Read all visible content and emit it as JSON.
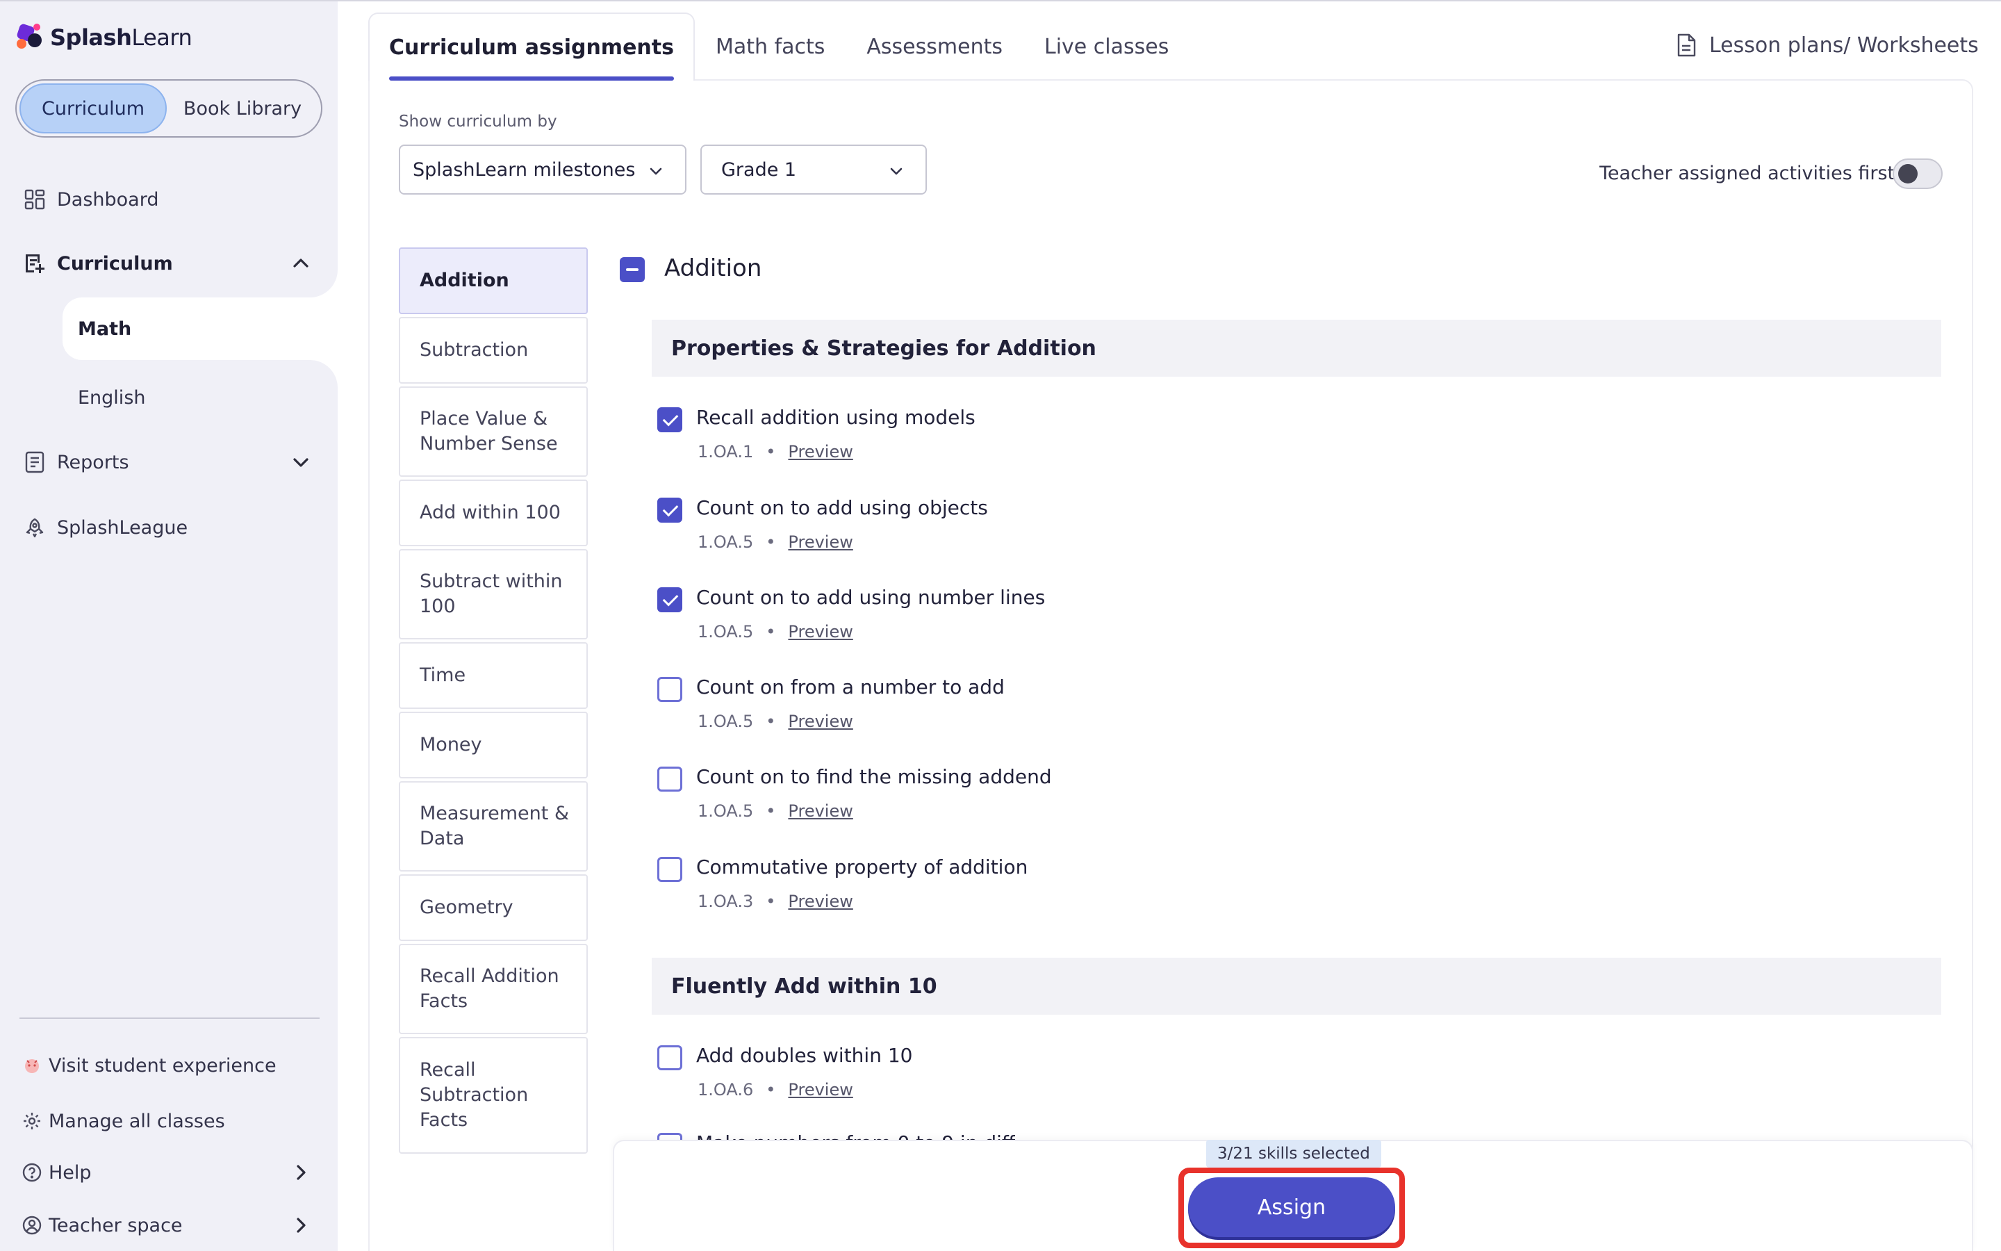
{
  "brand": {
    "name_bold": "Splash",
    "name_light": "Learn"
  },
  "sidebar": {
    "segments": [
      {
        "label": "Curriculum",
        "active": true
      },
      {
        "label": "Book Library",
        "active": false
      }
    ],
    "nav": {
      "dashboard": "Dashboard",
      "curriculum": "Curriculum",
      "math": "Math",
      "english": "English",
      "reports": "Reports",
      "league": "SplashLeague"
    },
    "bottom": {
      "visit": "Visit student experience",
      "manage": "Manage all classes",
      "help": "Help",
      "teacher": "Teacher space"
    }
  },
  "tabs": [
    {
      "label": "Curriculum assignments",
      "active": true
    },
    {
      "label": "Math facts",
      "active": false
    },
    {
      "label": "Assessments",
      "active": false
    },
    {
      "label": "Live classes",
      "active": false
    }
  ],
  "lesson_link": "Lesson plans/ Worksheets",
  "filters": {
    "label": "Show curriculum by",
    "curriculum_value": "SplashLearn milestones",
    "grade_value": "Grade 1",
    "toggle_label": "Teacher assigned activities first",
    "toggle_on": false
  },
  "topics": [
    "Addition",
    "Subtraction",
    "Place Value & Number Sense",
    "Add within 100",
    "Subtract within 100",
    "Time",
    "Money",
    "Measurement & Data",
    "Geometry",
    "Recall Addition Facts",
    "Recall Subtraction Facts"
  ],
  "active_topic": "Addition",
  "section": {
    "title": "Addition",
    "groups": [
      {
        "title": "Properties & Strategies for Addition",
        "skills": [
          {
            "name": "Recall addition using models",
            "code": "1.OA.1",
            "preview": "Preview",
            "checked": true
          },
          {
            "name": "Count on to add using objects",
            "code": "1.OA.5",
            "preview": "Preview",
            "checked": true
          },
          {
            "name": "Count on to add using number lines",
            "code": "1.OA.5",
            "preview": "Preview",
            "checked": true
          },
          {
            "name": "Count on from a number to add",
            "code": "1.OA.5",
            "preview": "Preview",
            "checked": false
          },
          {
            "name": "Count on to find the missing addend",
            "code": "1.OA.5",
            "preview": "Preview",
            "checked": false
          },
          {
            "name": "Commutative property of addition",
            "code": "1.OA.3",
            "preview": "Preview",
            "checked": false
          }
        ]
      },
      {
        "title": "Fluently Add within 10",
        "skills": [
          {
            "name": "Add doubles within 10",
            "code": "1.OA.6",
            "preview": "Preview",
            "checked": false
          }
        ]
      }
    ],
    "partial_skill_text": "Make numbers from 0 to 9 in diff"
  },
  "footer": {
    "selected_count": "3/21 skills selected",
    "assign_label": "Assign"
  },
  "colors": {
    "accent": "#4b4fc7",
    "sidebar_bg": "#f0f0f7",
    "segment_active": "#b7d1f7",
    "highlight": "#e8322b"
  }
}
